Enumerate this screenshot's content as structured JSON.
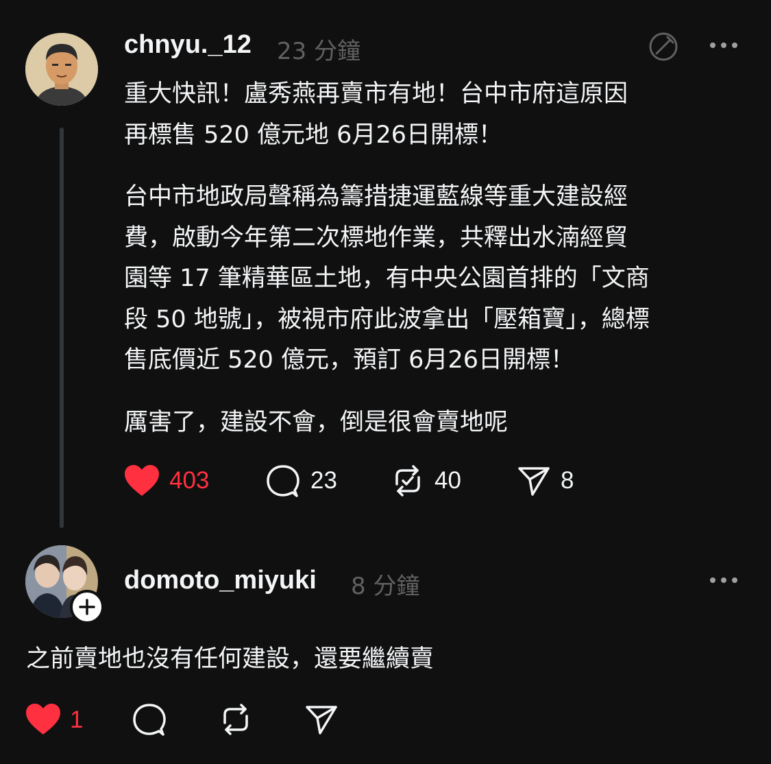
{
  "post": {
    "username": "chnyu._12",
    "time": "23 分鐘",
    "paragraphs": [
      [
        "重大快訊！盧秀燕再賣市有地！台中市府這原因",
        "再標售 520 億元地 6月26日開標！"
      ],
      [
        "台中市地政局聲稱為籌措捷運藍線等重大建設經",
        "費，啟動今年第二次標地作業，共釋出水湳經貿",
        "園等 17 筆精華區土地，有中央公園首排的「文商",
        "段 50 地號」，被視市府此波拿出「壓箱寶」，總標",
        "售底價近 520 億元，預訂 6月26日開標！"
      ],
      [
        "厲害了，建設不會，倒是很會賣地呢"
      ]
    ],
    "likes": "403",
    "comments": "23",
    "reposts": "40",
    "shares": "8",
    "liked": true
  },
  "reply": {
    "username": "domoto_miyuki",
    "time": "8 分鐘",
    "text": "之前賣地也沒有任何建設，還要繼續賣",
    "likes": "1",
    "liked": true
  },
  "colors": {
    "background": "#101010",
    "text": "#f3f5f7",
    "muted": "#616161",
    "like": "#ff3040",
    "thread_line": "#333638"
  },
  "icons": {
    "options": "more-horizontal-icon",
    "translate": "translate-icon",
    "like": "heart-filled-icon",
    "comment": "speech-bubble-icon",
    "repost": "repost-icon",
    "share": "paper-plane-icon",
    "follow": "plus-icon"
  }
}
